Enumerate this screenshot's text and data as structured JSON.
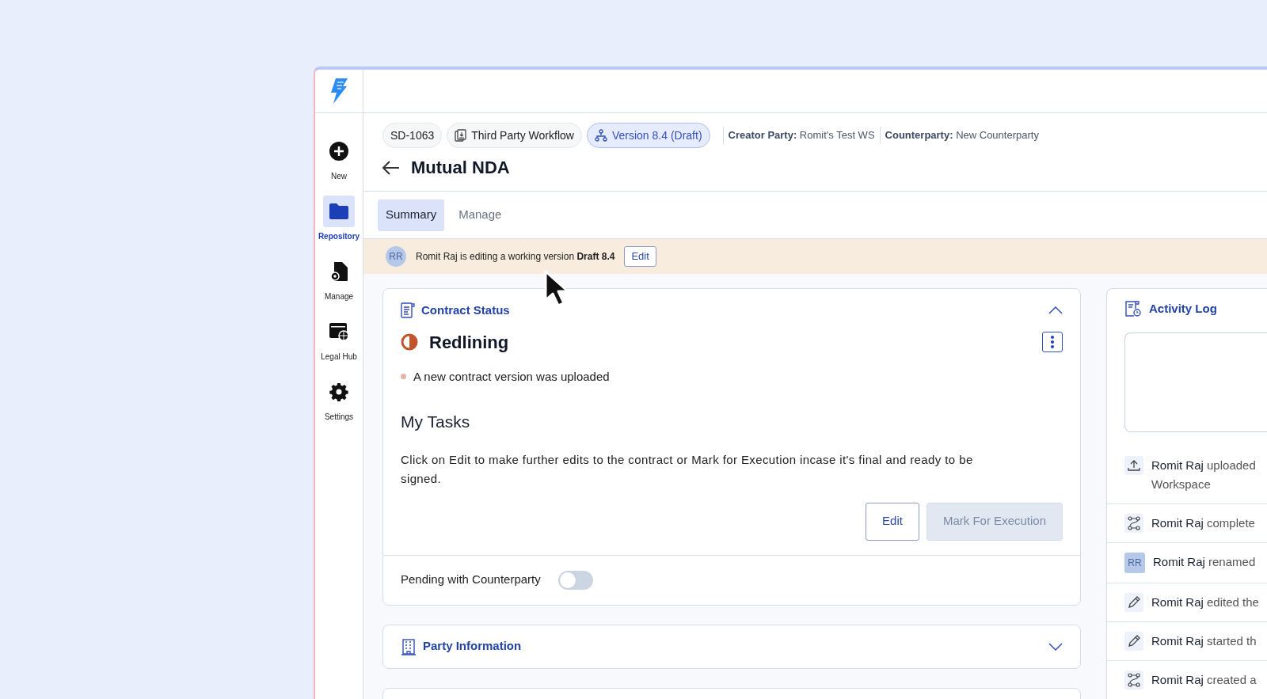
{
  "sidebar": {
    "items": [
      {
        "label": "New",
        "kind": "plus",
        "selected": false
      },
      {
        "label": "Repository",
        "kind": "folder",
        "selected": true
      },
      {
        "label": "Manage",
        "kind": "document",
        "selected": false
      },
      {
        "label": "Legal Hub",
        "kind": "browser",
        "selected": false
      },
      {
        "label": "Settings",
        "kind": "settings",
        "selected": false
      }
    ]
  },
  "header": {
    "chips": [
      {
        "label": "SD-1063",
        "kind": "plain"
      },
      {
        "label": "Third Party Workflow",
        "kind": "workflow"
      },
      {
        "label": "Version 8.4 (Draft)",
        "kind": "version"
      }
    ],
    "meta": [
      {
        "label": "Creator Party:",
        "value": "Romit's Test WS"
      },
      {
        "label": "Counterparty:",
        "value": "New Counterparty"
      }
    ],
    "title": "Mutual NDA"
  },
  "tabs": [
    {
      "label": "Summary",
      "selected": true
    },
    {
      "label": "Manage",
      "selected": false
    }
  ],
  "banner": {
    "avatar": "RR",
    "text": "Romit Raj is editing a working version **Draft 8.4**",
    "button": "Edit"
  },
  "contract_status": {
    "title": "Contract Status",
    "expanded": true,
    "status": "Redlining",
    "note": "A new contract version was uploaded",
    "tasks_title": "My Tasks",
    "tasks_text": "Click on Edit to make further edits to the contract or Mark for Execution incase it's final and ready to be signed.",
    "buttons": [
      {
        "label": "Edit",
        "disabled": false
      },
      {
        "label": "Mark For Execution",
        "disabled": true
      }
    ],
    "toggle": {
      "label": "Pending with Counterparty",
      "on": false
    }
  },
  "party_information": {
    "title": "Party Information",
    "expanded": false
  },
  "activity_log": {
    "title": "Activity Log",
    "items": [
      {
        "kind": "upload",
        "text": "**Romit Raj** uploaded",
        "text2": "Workspace"
      },
      {
        "kind": "workflow",
        "text": "**Romit Raj** complete"
      },
      {
        "kind": "avatar",
        "avatar": "RR",
        "text": "**Romit Raj** renamed"
      },
      {
        "kind": "pencil",
        "text": "**Romit Raj** edited the"
      },
      {
        "kind": "pencil",
        "text": "**Romit Raj** started th"
      },
      {
        "kind": "workflow",
        "text": "**Romit Raj** created a"
      }
    ]
  }
}
